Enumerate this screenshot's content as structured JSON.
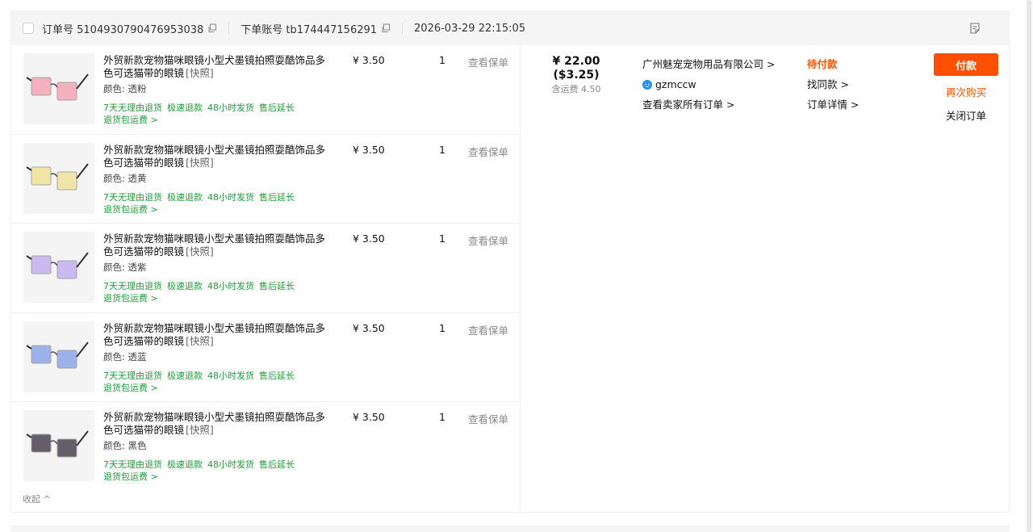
{
  "header": {
    "order_no": "订单号 5104930790476953038",
    "account": "下单账号 tb174447156291",
    "datetime": "2026-03-29 22:15:05"
  },
  "items": [
    {
      "title": "外贸新款宠物猫咪眼镜小型犬墨镜拍照耍酷饰品多色可选猫带的眼镜",
      "snapshot": "[快照]",
      "spec": "颜色: 透粉",
      "price": "¥ 3.50",
      "qty": "1",
      "warranty": "查看保单",
      "lens_color": "#f2a6b3"
    },
    {
      "title": "外贸新款宠物猫咪眼镜小型犬墨镜拍照耍酷饰品多色可选猫带的眼镜",
      "snapshot": "[快照]",
      "spec": "颜色: 透黄",
      "price": "¥ 3.50",
      "qty": "1",
      "warranty": "查看保单",
      "lens_color": "#efe39a"
    },
    {
      "title": "外贸新款宠物猫咪眼镜小型犬墨镜拍照耍酷饰品多色可选猫带的眼镜",
      "snapshot": "[快照]",
      "spec": "颜色: 透紫",
      "price": "¥ 3.50",
      "qty": "1",
      "warranty": "查看保单",
      "lens_color": "#c2b2ef"
    },
    {
      "title": "外贸新款宠物猫咪眼镜小型犬墨镜拍照耍酷饰品多色可选猫带的眼镜",
      "snapshot": "[快照]",
      "spec": "颜色: 透蓝",
      "price": "¥ 3.50",
      "qty": "1",
      "warranty": "查看保单",
      "lens_color": "#8fa6e8"
    },
    {
      "title": "外贸新款宠物猫咪眼镜小型犬墨镜拍照耍酷饰品多色可选猫带的眼镜",
      "snapshot": "[快照]",
      "spec": "颜色: 黑色",
      "price": "¥ 3.50",
      "qty": "1",
      "warranty": "查看保单",
      "lens_color": "#4a4550"
    }
  ],
  "services": {
    "s1": "7天无理由退货",
    "s2": "极速退款",
    "s3": "48小时发货",
    "s4": "售后延长",
    "s5": "退货包运费 >"
  },
  "collapse_label": "收起 ^",
  "total": {
    "cny": "¥ 22.00",
    "usd": "($3.25)",
    "shipping": "含运费 4.50"
  },
  "seller": {
    "name": "广州魅宠宠物用品有限公司 >",
    "wangwang": "gzmccw",
    "all_orders": "查看卖家所有订单 >"
  },
  "status": {
    "label": "待付款",
    "similar": "找同款 >",
    "detail": "订单详情 >"
  },
  "actions": {
    "pay": "付款",
    "rebuy": "再次购买",
    "close": "关闭订单"
  },
  "colors": {
    "accent": "#ff5000",
    "service_green": "#1f9d3a"
  }
}
